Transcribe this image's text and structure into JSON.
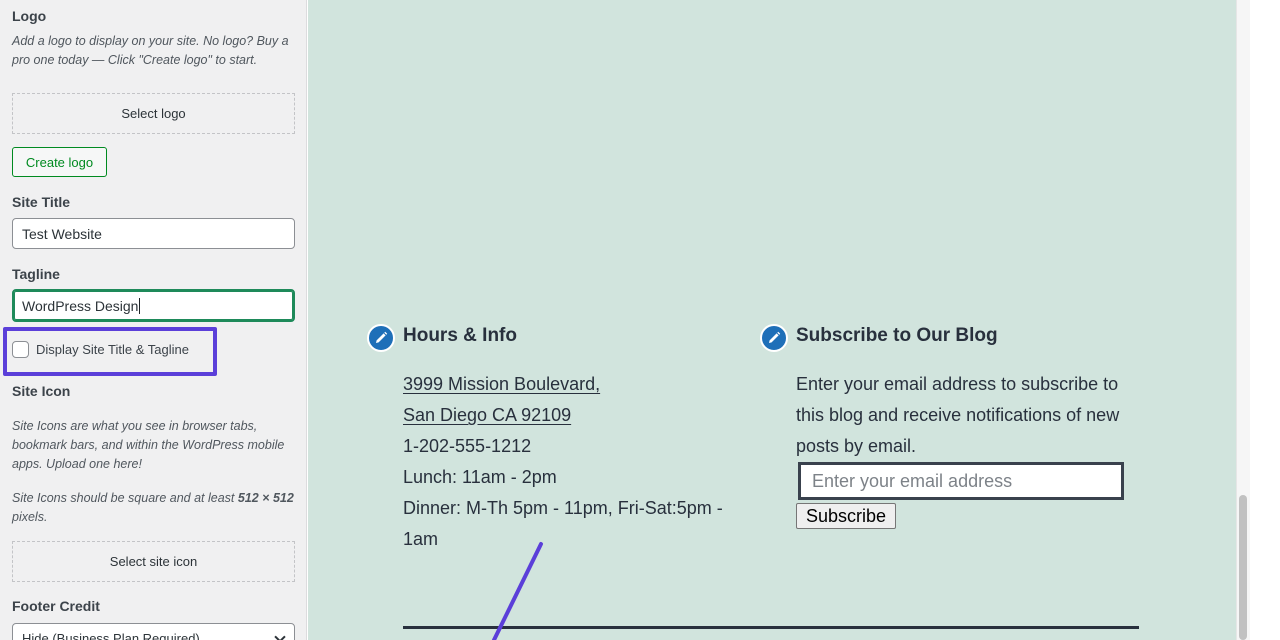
{
  "customizer": {
    "logo": {
      "title": "Logo",
      "description": "Add a logo to display on your site. No logo? Buy a pro one today — Click \"Create logo\" to start.",
      "select_button": "Select logo",
      "create_button": "Create logo"
    },
    "site_title": {
      "label": "Site Title",
      "value": "Test Website"
    },
    "tagline": {
      "label": "Tagline",
      "value": "WordPress Design"
    },
    "display_checkbox": {
      "label": "Display Site Title & Tagline",
      "checked": false
    },
    "site_icon": {
      "title": "Site Icon",
      "description1": "Site Icons are what you see in browser tabs, bookmark bars, and within the WordPress mobile apps. Upload one here!",
      "description2_prefix": "Site Icons should be square and at least ",
      "description2_bold": "512 × 512",
      "description2_suffix": " pixels.",
      "select_button": "Select site icon"
    },
    "footer_credit": {
      "label": "Footer Credit",
      "selected": "Hide (Business Plan Required)"
    }
  },
  "preview": {
    "hours_widget": {
      "title": "Hours & Info",
      "address_line1": "3999 Mission Boulevard,",
      "address_line2": "San Diego CA 92109",
      "phone": "1-202-555-1212",
      "lunch": "Lunch: 11am - 2pm",
      "dinner_line1": "Dinner: M-Th 5pm - 11pm, Fri-Sat:5pm -",
      "dinner_line2": "1am"
    },
    "subscribe_widget": {
      "title": "Subscribe to Our Blog",
      "text_line1": "Enter your email address to subscribe to",
      "text_line2": "this blog and receive notifications of new",
      "text_line3": "posts by email.",
      "email_placeholder": "Enter your email address",
      "button": "Subscribe"
    }
  },
  "colors": {
    "preview_bg": "#d1e4dd",
    "highlight": "#5b3fd9",
    "edit_icon": "#1e6fb8",
    "create_button": "#008a20"
  }
}
